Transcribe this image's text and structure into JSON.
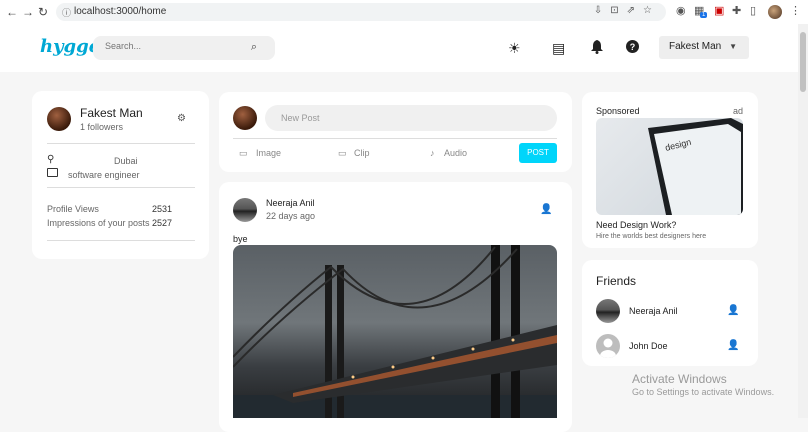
{
  "browser": {
    "url": "localhost:3000/home",
    "extension_badge": "1"
  },
  "navbar": {
    "logo": "hygge",
    "search_placeholder": "Search...",
    "user_name": "Fakest Man"
  },
  "profile": {
    "name": "Fakest Man",
    "followers": "1 followers",
    "location": "Dubai",
    "occupation": "software engineer",
    "stats": [
      {
        "label": "Profile Views",
        "value": "2531"
      },
      {
        "label": "Impressions of your posts",
        "value": "2527"
      }
    ]
  },
  "new_post": {
    "placeholder": "New Post",
    "options": [
      "Image",
      "Clip",
      "Audio"
    ],
    "button": "POST"
  },
  "post": {
    "author": "Neeraja Anil",
    "time": "22 days ago",
    "text": "bye"
  },
  "sponsored": {
    "heading": "Sponsored",
    "ad_label": "ad",
    "title": "Need Design Work?",
    "subtitle": "Hire the worlds best designers here",
    "screen_text": "design"
  },
  "friends": {
    "heading": "Friends",
    "items": [
      {
        "name": "Neeraja Anil"
      },
      {
        "name": "John Doe"
      }
    ]
  },
  "windows": {
    "title": "Activate Windows",
    "subtitle": "Go to Settings to activate Windows."
  },
  "colors": {
    "accent": "#00d5fa",
    "logo": "#00a8d4"
  }
}
